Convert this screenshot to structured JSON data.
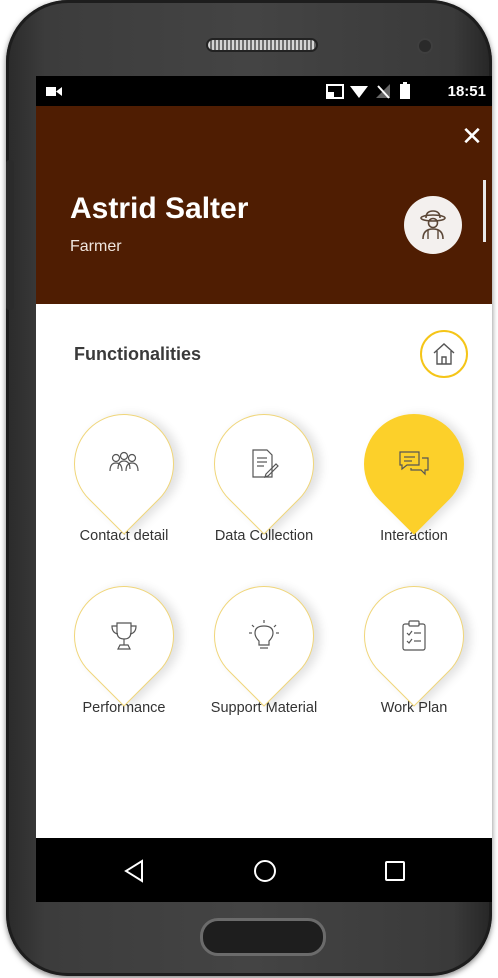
{
  "status_bar": {
    "time": "18:51"
  },
  "header": {
    "user_name": "Astrid Salter",
    "user_role": "Farmer",
    "close_glyph": "✕"
  },
  "section": {
    "title": "Functionalities"
  },
  "functionalities": [
    {
      "label": "Contact detail",
      "icon": "people-icon",
      "active": false
    },
    {
      "label": "Data Collection",
      "icon": "document-edit-icon",
      "active": false
    },
    {
      "label": "Interaction",
      "icon": "chat-bubbles-icon",
      "active": true
    },
    {
      "label": "Performance",
      "icon": "trophy-icon",
      "active": false
    },
    {
      "label": "Support Material",
      "icon": "lightbulb-icon",
      "active": false
    },
    {
      "label": "Work Plan",
      "icon": "clipboard-checklist-icon",
      "active": false
    }
  ],
  "colors": {
    "header_bg": "#4f1d02",
    "accent": "#fcd02a",
    "navbar_bg": "#000000"
  }
}
